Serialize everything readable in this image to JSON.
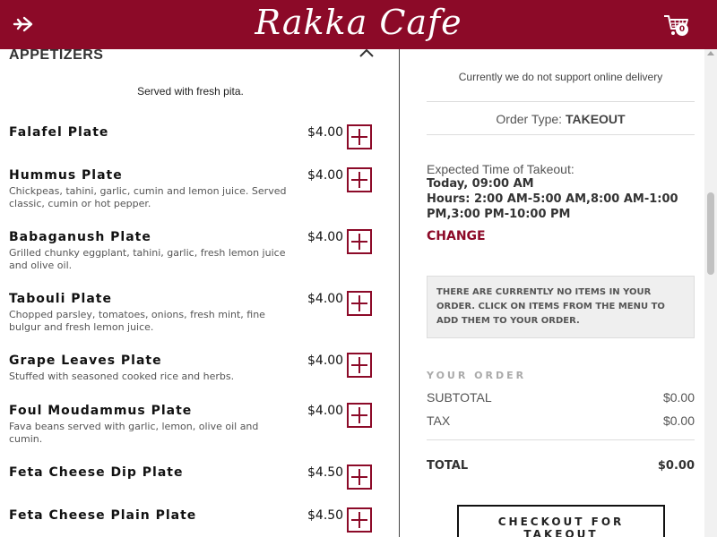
{
  "header": {
    "brand": "Rakka Cafe",
    "cart_count": "0"
  },
  "menu": {
    "section_title": "APPETIZERS",
    "section_note": "Served with fresh pita.",
    "items": [
      {
        "name": "Falafel Plate",
        "price": "$4.00",
        "desc": ""
      },
      {
        "name": "Hummus Plate",
        "price": "$4.00",
        "desc": "Chickpeas, tahini, garlic, cumin and lemon juice. Served classic, cumin or hot pepper."
      },
      {
        "name": "Babaganush Plate",
        "price": "$4.00",
        "desc": "Grilled chunky eggplant, tahini, garlic, fresh lemon juice and olive oil."
      },
      {
        "name": "Tabouli Plate",
        "price": "$4.00",
        "desc": "Chopped parsley, tomatoes, onions, fresh mint, fine bulgur and fresh lemon juice."
      },
      {
        "name": "Grape Leaves Plate",
        "price": "$4.00",
        "desc": "Stuffed with seasoned cooked rice and herbs."
      },
      {
        "name": "Foul Moudammus Plate",
        "price": "$4.00",
        "desc": "Fava beans served with garlic, lemon, olive oil and cumin."
      },
      {
        "name": "Feta Cheese Dip Plate",
        "price": "$4.50",
        "desc": ""
      },
      {
        "name": "Feta Cheese Plain Plate",
        "price": "$4.50",
        "desc": ""
      }
    ]
  },
  "order": {
    "delivery_note": "Currently we do not support online delivery",
    "order_type_label": "Order Type:",
    "order_type_value": "TAKEOUT",
    "expected_label": "Expected Time of Takeout:",
    "expected_value": "Today, 09:00 AM",
    "hours": "Hours: 2:00 AM-5:00 AM,8:00 AM-1:00 PM,3:00 PM-10:00 PM",
    "change_label": "CHANGE",
    "empty_message": "THERE ARE CURRENTLY NO ITEMS IN YOUR ORDER. CLICK ON ITEMS FROM THE MENU TO ADD THEM TO YOUR ORDER.",
    "your_order_label": "YOUR ORDER",
    "subtotal_label": "SUBTOTAL",
    "subtotal_value": "$0.00",
    "tax_label": "TAX",
    "tax_value": "$0.00",
    "total_label": "TOTAL",
    "total_value": "$0.00",
    "checkout_label": "CHECKOUT FOR TAKEOUT"
  },
  "colors": {
    "brand": "#8c0a28",
    "accent": "#8c0a28"
  },
  "icons": {
    "back": "airplane-back-icon",
    "cart": "cart-icon",
    "collapse": "chevron-up-icon",
    "add": "plus-icon"
  }
}
